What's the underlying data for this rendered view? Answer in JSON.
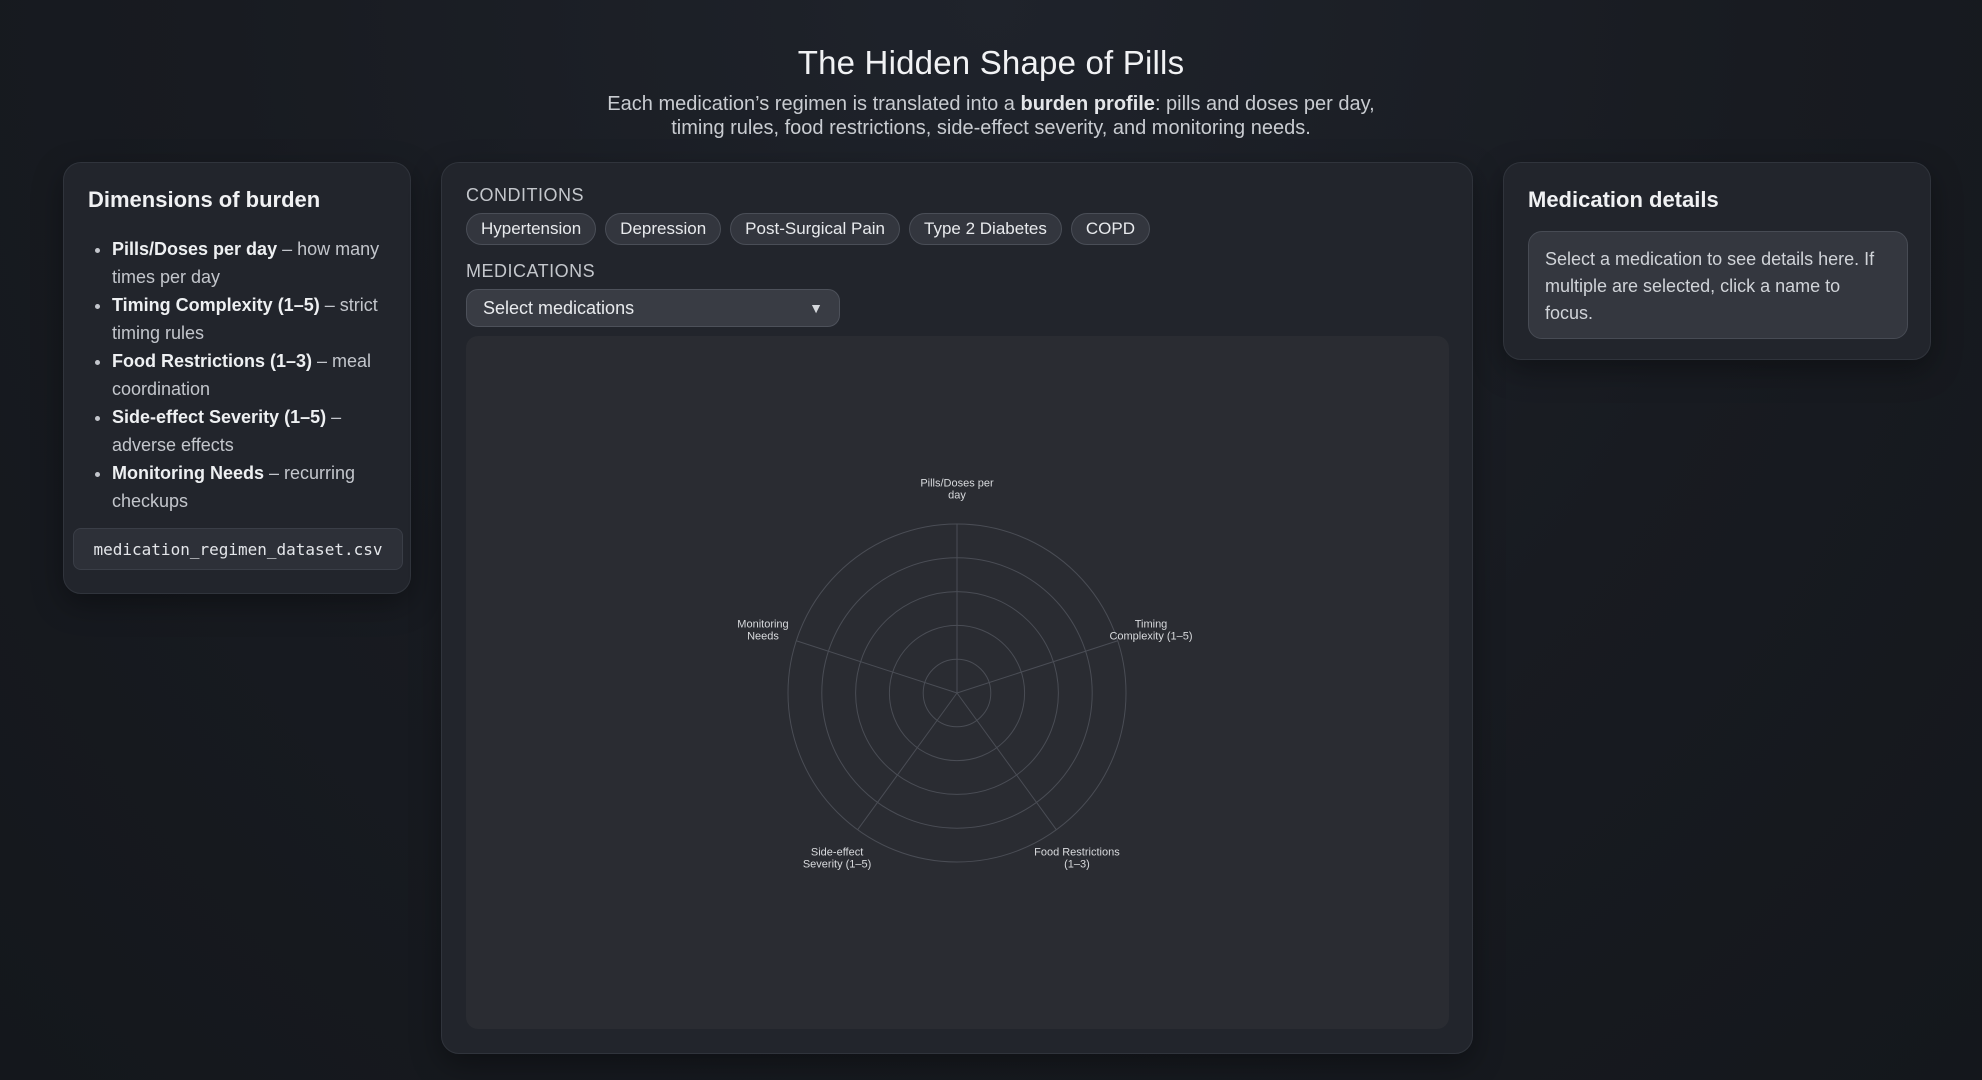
{
  "header": {
    "title": "The Hidden Shape of Pills",
    "subtitle_pre": "Each medication’s regimen is translated into a ",
    "subtitle_bold": "burden profile",
    "subtitle_post": ": pills and doses per day, timing rules, food restrictions, side-effect severity, and monitoring needs."
  },
  "left": {
    "title": "Dimensions of burden",
    "items": [
      {
        "term": "Pills/Doses per day",
        "desc": " – how many times per day"
      },
      {
        "term": "Timing Complexity (1–5)",
        "desc": " – strict timing rules"
      },
      {
        "term": "Food Restrictions (1–3)",
        "desc": " – meal coordination"
      },
      {
        "term": "Side-effect Severity (1–5)",
        "desc": " – adverse effects"
      },
      {
        "term": "Monitoring Needs",
        "desc": " – recurring checkups"
      }
    ],
    "file": "medication_regimen_dataset.csv"
  },
  "center": {
    "conditions_label": "CONDITIONS",
    "conditions": [
      "Hypertension",
      "Depression",
      "Post-Surgical Pain",
      "Type 2 Diabetes",
      "COPD"
    ],
    "medications_label": "MEDICATIONS",
    "medications_select": "Select medications",
    "caret": "▼"
  },
  "chart_data": {
    "type": "radar",
    "axes": [
      [
        "Pills/Doses per",
        "day"
      ],
      [
        "Timing",
        "Complexity (1–5)"
      ],
      [
        "Food Restrictions",
        "(1–3)"
      ],
      [
        "Side-effect",
        "Severity (1–5)"
      ],
      [
        "Monitoring",
        "Needs"
      ]
    ],
    "rings": 5,
    "series": [],
    "colors": {
      "grid": "#4a4d55",
      "label": "#d8dadd"
    }
  },
  "right": {
    "title": "Medication details",
    "placeholder": "Select a medication to see details here. If multiple are selected, click a name to focus."
  }
}
